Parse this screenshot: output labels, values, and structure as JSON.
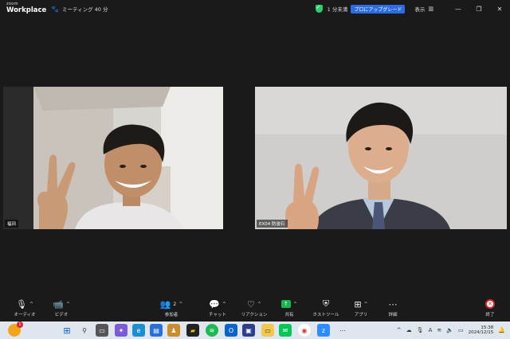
{
  "titlebar": {
    "brand_small": "zoom",
    "brand_big": "Workplace",
    "meeting_label": "ミーティング 40 分",
    "remaining_time": "1 分未満",
    "upgrade_label": "プロにアップグレード",
    "view_label": "表示"
  },
  "participants": [
    {
      "name": "福田"
    },
    {
      "name": "EX04 防波石"
    }
  ],
  "toolbar": {
    "audio": "オーディオ",
    "video": "ビデオ",
    "participants": "参加者",
    "participants_count": "2",
    "chat": "チャット",
    "reactions": "リアクション",
    "share": "共有",
    "host_tools": "ホストツール",
    "apps": "アプリ",
    "more": "詳細",
    "end": "終了"
  },
  "taskbar": {
    "time": "15:38",
    "date": "2024/12/15",
    "notification_badge": "1"
  },
  "icons": {
    "mic": "microphone-icon",
    "camera": "camera-icon",
    "participants": "people-icon",
    "chat": "chat-bubble-icon",
    "reactions": "heart-icon",
    "share": "share-arrow-icon",
    "host": "shield-icon",
    "apps": "apps-grid-icon",
    "more": "more-dots-icon",
    "end": "close-x-icon"
  },
  "colors": {
    "background": "#1a1a1a",
    "accent_blue": "#2d6be4",
    "share_green": "#18b64f",
    "end_red": "#e02828",
    "secure_green": "#2ecc71"
  }
}
